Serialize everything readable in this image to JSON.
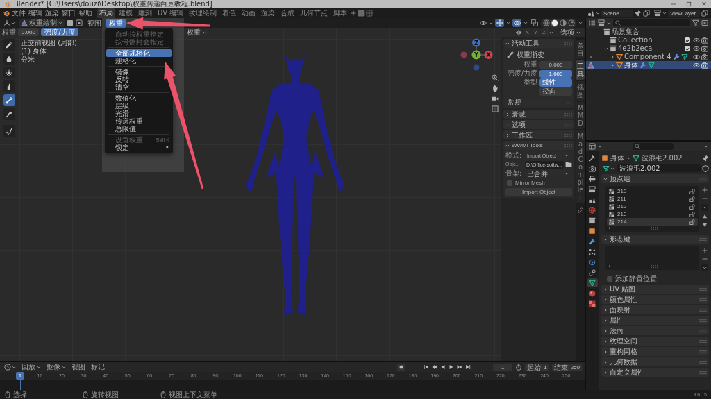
{
  "window": {
    "title": "Blender* [C:\\Users\\douzi\\Desktop\\权重传递白豆教程.blend]"
  },
  "menu_bar": [
    "文件",
    "编辑",
    "渲染",
    "窗口",
    "帮助"
  ],
  "workspaces": [
    {
      "label": "布局",
      "selected": true
    },
    {
      "label": "建模",
      "selected": false
    },
    {
      "label": "雕刻",
      "selected": false
    },
    {
      "label": "UV 编辑",
      "selected": false
    },
    {
      "label": "纹理绘制",
      "selected": false
    },
    {
      "label": "着色",
      "selected": false
    },
    {
      "label": "动画",
      "selected": false
    },
    {
      "label": "渲染",
      "selected": false
    },
    {
      "label": "合成",
      "selected": false
    },
    {
      "label": "几何节点",
      "selected": false
    },
    {
      "label": "脚本",
      "selected": false
    }
  ],
  "scene": {
    "name": "Scene",
    "view_layer": "ViewLayer"
  },
  "viewport": {
    "mode": "权重绘制",
    "menus": [
      {
        "label": "视图",
        "selected": false
      },
      {
        "label": "权重",
        "selected": true
      }
    ],
    "toggles": [
      {
        "kind": "gizmo",
        "on": true
      },
      {
        "kind": "overlay",
        "on": true
      },
      {
        "kind": "xray",
        "on": false
      }
    ],
    "shading": [
      {
        "kind": "wireframe",
        "selected": false
      },
      {
        "kind": "solid",
        "selected": true
      },
      {
        "kind": "material",
        "selected": false
      },
      {
        "kind": "rendered",
        "selected": false
      }
    ],
    "tool_settings": {
      "weight_label": "权重",
      "weight_value": "0.000",
      "strength": {
        "label": "强度/力度",
        "level": 1
      },
      "blend": "权重"
    },
    "mirror_axes": [
      {
        "label": "X",
        "selected": false
      },
      {
        "label": "Y",
        "selected": false
      },
      {
        "label": "Z",
        "selected": false
      }
    ],
    "options": "选项",
    "info": [
      "正交前视图 (局部)",
      "(1) 身体",
      "分米"
    ],
    "tools": [
      {
        "kind": "draw",
        "selected": false
      },
      {
        "kind": "blur",
        "selected": false
      },
      {
        "kind": "average",
        "selected": false
      },
      {
        "kind": "smear",
        "selected": false
      },
      {
        "kind": "gradient",
        "selected": true
      },
      {
        "kind": "sample",
        "selected": false
      },
      {
        "kind": "annotate",
        "selected": false
      }
    ],
    "gizmo": {
      "z": "Z",
      "y": "Y",
      "x": "X"
    }
  },
  "weights_menu": {
    "items": [
      {
        "kind": "item",
        "label": "自动按权重指定",
        "disabled": true,
        "selected": false
      },
      {
        "kind": "item",
        "label": "按骨骼封套指定",
        "disabled": true,
        "selected": false
      },
      {
        "kind": "separator"
      },
      {
        "kind": "item",
        "label": "全部规格化",
        "disabled": false,
        "selected": true
      },
      {
        "kind": "item",
        "label": "规格化",
        "disabled": false,
        "selected": false
      },
      {
        "kind": "separator"
      },
      {
        "kind": "item",
        "label": "镜像",
        "disabled": false,
        "selected": false
      },
      {
        "kind": "item",
        "label": "反转",
        "disabled": false,
        "selected": false
      },
      {
        "kind": "item",
        "label": "清空",
        "disabled": false,
        "selected": false
      },
      {
        "kind": "separator"
      },
      {
        "kind": "item",
        "label": "数值化",
        "disabled": false,
        "selected": false
      },
      {
        "kind": "item",
        "label": "层级",
        "disabled": false,
        "selected": false
      },
      {
        "kind": "item",
        "label": "光滑",
        "disabled": false,
        "selected": false
      },
      {
        "kind": "item",
        "label": "传递权重",
        "disabled": false,
        "selected": false
      },
      {
        "kind": "item",
        "label": "总限值",
        "disabled": false,
        "selected": false
      },
      {
        "kind": "separator"
      },
      {
        "kind": "item",
        "label": "设置权重",
        "shortcut": "Shift K",
        "disabled": true,
        "selected": false
      },
      {
        "kind": "submenu",
        "label": "锁定",
        "disabled": false,
        "selected": false
      }
    ]
  },
  "sidebar": {
    "tabs": [
      {
        "label": "条目",
        "selected": false
      },
      {
        "label": "工具",
        "selected": true
      },
      {
        "label": "视图",
        "selected": false
      },
      {
        "label": "MMD",
        "selected": false
      },
      {
        "label": "MadCompiler",
        "selected": false
      }
    ],
    "active_tool": {
      "title": "活动工具",
      "expanded": true,
      "tool_name": "权重渐变",
      "weight_label": "权重",
      "weight_value": "0.000",
      "strength": {
        "label": "强度/力度",
        "value": "1.000",
        "level": 1
      },
      "type_label": "类型",
      "types": [
        {
          "label": "线性",
          "selected": true
        },
        {
          "label": "径向",
          "selected": false
        }
      ],
      "preset": "常规"
    },
    "panels": [
      {
        "title": "衰减",
        "expanded": false
      },
      {
        "title": "选项",
        "expanded": false
      },
      {
        "title": "工作区",
        "expanded": false
      }
    ],
    "wwmi": {
      "title": "WWMI Tools",
      "expanded": true,
      "mode_label": "模式:",
      "mode": "Import Object",
      "object_label": "Obje...",
      "object_path": "D:\\Office-softw...",
      "skeleton_label": "骨架:",
      "skeleton": "已合并",
      "mirror_mesh": {
        "label": "Mirror Mesh",
        "checked": false
      },
      "button": "Import Object"
    }
  },
  "outliner": {
    "tree": [
      {
        "kind": "scene_collection",
        "label": "场景集合",
        "selected": false,
        "children": [
          {
            "kind": "collection",
            "label": "Collection",
            "checked": true,
            "selected": false
          },
          {
            "kind": "collection",
            "label": "4e2b2eca",
            "checked": true,
            "expanded": true,
            "selected": false,
            "children": [
              {
                "kind": "object",
                "label": "Component 4",
                "expanded": false,
                "selected": false
              },
              {
                "kind": "object",
                "label": "身体",
                "expanded": false,
                "selected": true
              }
            ]
          }
        ]
      }
    ]
  },
  "properties": {
    "tabs": [
      {
        "kind": "tool",
        "selected": false
      },
      {
        "kind": "render",
        "selected": false
      },
      {
        "kind": "output",
        "selected": false
      },
      {
        "kind": "view_layer",
        "selected": false
      },
      {
        "kind": "scene",
        "selected": false
      },
      {
        "kind": "world",
        "selected": false
      },
      {
        "kind": "collection",
        "selected": false
      },
      {
        "kind": "object",
        "selected": false
      },
      {
        "kind": "modifiers",
        "selected": false
      },
      {
        "kind": "particles",
        "selected": false
      },
      {
        "kind": "physics",
        "selected": false
      },
      {
        "kind": "constraints",
        "selected": false
      },
      {
        "kind": "data",
        "selected": true
      },
      {
        "kind": "material",
        "selected": false
      },
      {
        "kind": "texture",
        "selected": false
      }
    ],
    "breadcrumb": [
      "身体",
      "波浪毛2.002"
    ],
    "datablock": "波浪毛2.002",
    "vertex_groups": {
      "title": "顶点组",
      "expanded": true,
      "items": [
        {
          "label": "210",
          "selected": false
        },
        {
          "label": "211",
          "selected": false
        },
        {
          "label": "212",
          "selected": false
        },
        {
          "label": "213",
          "selected": false
        },
        {
          "label": "214",
          "selected": true
        }
      ]
    },
    "shape_keys": {
      "title": "形态键",
      "expanded": true
    },
    "rest_position": {
      "label": "添加静置位置",
      "checked": false
    },
    "panels": [
      {
        "title": "UV 贴图",
        "expanded": false
      },
      {
        "title": "颜色属性",
        "expanded": false
      },
      {
        "title": "面映射",
        "expanded": false
      },
      {
        "title": "属性",
        "expanded": false
      },
      {
        "title": "法向",
        "expanded": false
      },
      {
        "title": "纹理空间",
        "expanded": false
      },
      {
        "title": "重构网格",
        "expanded": false
      },
      {
        "title": "几何数据",
        "expanded": false
      },
      {
        "title": "自定义属性",
        "expanded": false
      }
    ]
  },
  "timeline": {
    "menus": [
      {
        "label": "回放",
        "dropdown": true
      },
      {
        "label": "抠像",
        "dropdown": true
      },
      {
        "label": "视图",
        "dropdown": false
      },
      {
        "label": "标记",
        "dropdown": false
      }
    ],
    "current_frame": "1",
    "start_label": "起始",
    "start": "1",
    "end_label": "结束",
    "end": "250",
    "playhead": "1",
    "ruler": [
      "10",
      "20",
      "30",
      "40",
      "50",
      "60",
      "70",
      "80",
      "90",
      "100",
      "110",
      "120",
      "130",
      "140",
      "150",
      "160",
      "170",
      "180",
      "190",
      "200",
      "210",
      "220",
      "230",
      "240",
      "250"
    ]
  },
  "status_bar": {
    "hints": [
      "选择",
      "旋转视图",
      "视图上下文菜单"
    ],
    "version": "3.6.15"
  }
}
